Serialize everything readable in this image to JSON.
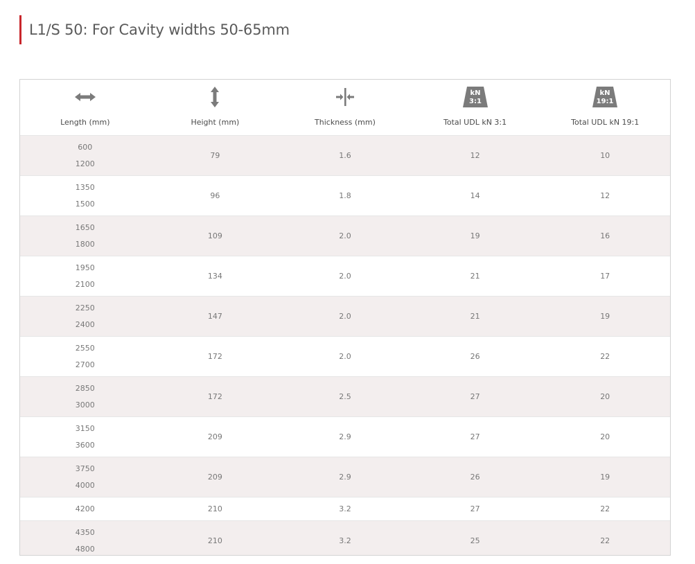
{
  "heading": "L1/S 50: For Cavity widths 50-65mm",
  "colors": {
    "accent": "#c8262c",
    "row_shade": "#f3eeee",
    "icon_gray": "#7b7b7b"
  },
  "columns": [
    {
      "key": "length",
      "label": "Length (mm)",
      "icon": "horizontal-double-arrow-icon"
    },
    {
      "key": "height",
      "label": "Height (mm)",
      "icon": "vertical-double-arrow-icon"
    },
    {
      "key": "thickness",
      "label": "Thickness (mm)",
      "icon": "thickness-arrows-icon"
    },
    {
      "key": "udl31",
      "label": "Total UDL kN 3:1",
      "icon": "kn-weight-icon",
      "icon_text_top": "kN",
      "icon_text_bottom": "3:1"
    },
    {
      "key": "udl191",
      "label": "Total UDL kN 19:1",
      "icon": "kn-weight-icon",
      "icon_text_top": "kN",
      "icon_text_bottom": "19:1"
    }
  ],
  "rows": [
    {
      "length": [
        "600",
        "1200"
      ],
      "height": "79",
      "thickness": "1.6",
      "udl31": "12",
      "udl191": "10"
    },
    {
      "length": [
        "1350",
        "1500"
      ],
      "height": "96",
      "thickness": "1.8",
      "udl31": "14",
      "udl191": "12"
    },
    {
      "length": [
        "1650",
        "1800"
      ],
      "height": "109",
      "thickness": "2.0",
      "udl31": "19",
      "udl191": "16"
    },
    {
      "length": [
        "1950",
        "2100"
      ],
      "height": "134",
      "thickness": "2.0",
      "udl31": "21",
      "udl191": "17"
    },
    {
      "length": [
        "2250",
        "2400"
      ],
      "height": "147",
      "thickness": "2.0",
      "udl31": "21",
      "udl191": "19"
    },
    {
      "length": [
        "2550",
        "2700"
      ],
      "height": "172",
      "thickness": "2.0",
      "udl31": "26",
      "udl191": "22"
    },
    {
      "length": [
        "2850",
        "3000"
      ],
      "height": "172",
      "thickness": "2.5",
      "udl31": "27",
      "udl191": "20"
    },
    {
      "length": [
        "3150",
        "3600"
      ],
      "height": "209",
      "thickness": "2.9",
      "udl31": "27",
      "udl191": "20"
    },
    {
      "length": [
        "3750",
        "4000"
      ],
      "height": "209",
      "thickness": "2.9",
      "udl31": "26",
      "udl191": "19"
    },
    {
      "length": [
        "4200"
      ],
      "height": "210",
      "thickness": "3.2",
      "udl31": "27",
      "udl191": "22"
    },
    {
      "length": [
        "4350",
        "4800"
      ],
      "height": "210",
      "thickness": "3.2",
      "udl31": "25",
      "udl191": "22"
    }
  ]
}
